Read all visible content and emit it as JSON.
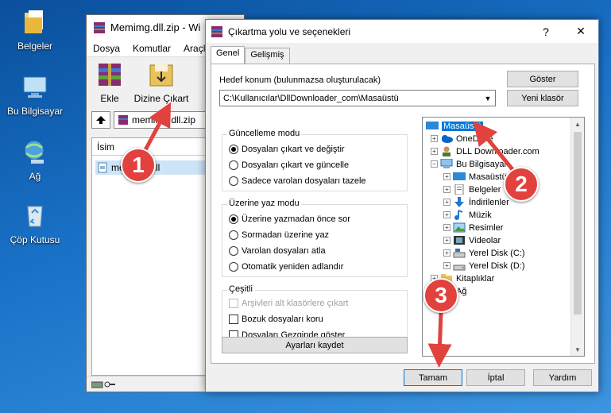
{
  "desktop": {
    "icons": [
      {
        "label": "Belgeler"
      },
      {
        "label": "Bu Bilgisayar"
      },
      {
        "label": "Ağ"
      },
      {
        "label": "Çöp Kutusu"
      }
    ]
  },
  "winrar": {
    "title": "Memimg.dll.zip - Wi",
    "menu": [
      "Dosya",
      "Komutlar",
      "Araçla"
    ],
    "tools": {
      "add": "Ekle",
      "extract_to": "Dizine Çıkart"
    },
    "path": "memimg.dll.zip",
    "list_header": "İsim",
    "file_name": "memimg.dll"
  },
  "dialog": {
    "title": "Çıkartma yolu ve seçenekleri",
    "help": "?",
    "close": "✕",
    "tabs": [
      "Genel",
      "Gelişmiş"
    ],
    "dest_label": "Hedef konum (bulunmazsa oluşturulacak)",
    "dest_value": "C:\\Kullanıcılar\\DllDownloader_com\\Masaüstü",
    "show_button": "Göster",
    "new_folder_button": "Yeni klasör",
    "update_mode": {
      "title": "Güncelleme modu",
      "options": [
        "Dosyaları çıkart ve değiştir",
        "Dosyaları çıkart ve güncelle",
        "Sadece varolan dosyaları tazele"
      ],
      "selected": 0
    },
    "overwrite_mode": {
      "title": "Üzerine yaz modu",
      "options": [
        "Üzerine yazmadan önce sor",
        "Sormadan üzerine yaz",
        "Varolan dosyaları atla",
        "Otomatik yeniden adlandır"
      ],
      "selected": 0
    },
    "misc": {
      "title": "Çeşitli",
      "options": [
        "Arşivleri alt klasörlere çıkart",
        "Bozuk dosyaları koru",
        "Dosyaları Gezginde göster"
      ]
    },
    "save_settings": "Ayarları kaydet",
    "tree": {
      "desktop": "Masaüstü",
      "onedrive": "OneDrive",
      "user": "DLL Downloader.com",
      "this_pc": "Bu Bilgisayar",
      "pc_desktop": "Masaüstü",
      "documents": "Belgeler",
      "downloads": "İndirilenler",
      "music": "Müzik",
      "pictures": "Resimler",
      "videos": "Videolar",
      "disk_c": "Yerel Disk (C:)",
      "disk_d": "Yerel Disk (D:)",
      "libraries": "Kitaplıklar",
      "network": "Ağ"
    },
    "ok": "Tamam",
    "cancel": "İptal",
    "help_button": "Yardım"
  },
  "markers": [
    "1",
    "2",
    "3"
  ],
  "colors": {
    "marker": "#e2423d",
    "selection": "#0078d7",
    "desktop_bg": "#1a73c9"
  }
}
